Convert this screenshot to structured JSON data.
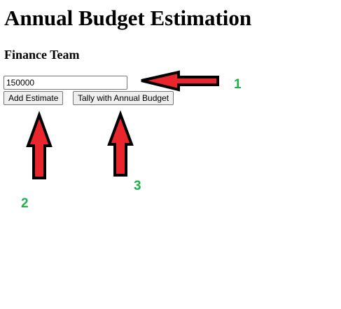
{
  "page": {
    "title": "Annual Budget Estimation",
    "team_heading": "Finance Team"
  },
  "form": {
    "estimate_value": "150000",
    "add_button_label": "Add Estimate",
    "tally_button_label": "Tally with Annual Budget"
  },
  "annotations": {
    "label_1": "1",
    "label_2": "2",
    "label_3": "3",
    "arrow_color": "#e8262b",
    "arrow_outline_color": "#000000",
    "label_color": "#22b04b"
  }
}
